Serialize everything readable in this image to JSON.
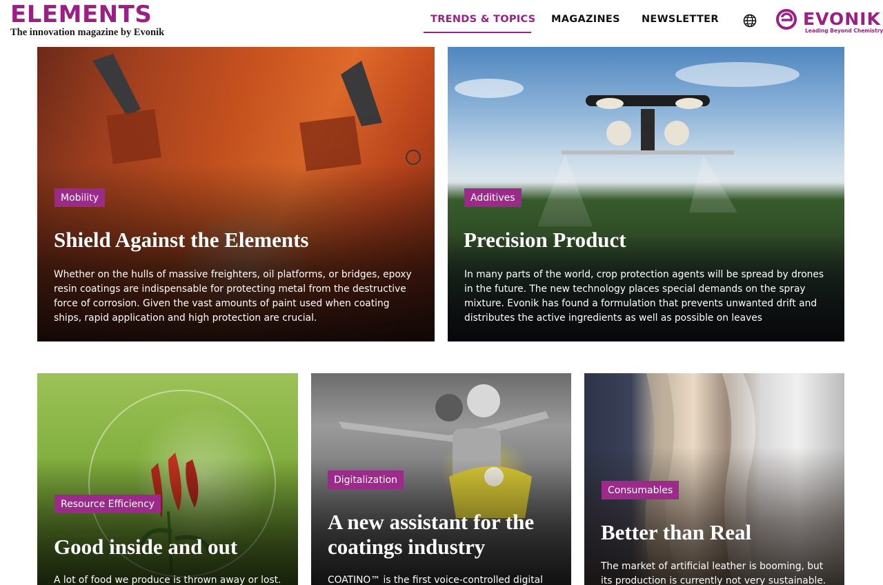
{
  "header": {
    "brand_title": "ELEMENTS",
    "brand_subtitle": "The innovation magazine by Evonik",
    "nav": [
      {
        "label": "TRENDS & TOPICS",
        "active": true
      },
      {
        "label": "MAGAZINES",
        "active": false
      },
      {
        "label": "NEWSLETTER",
        "active": false
      }
    ],
    "language_icon": "globe-icon",
    "logo_word": "EVONIK",
    "logo_tagline": "Leading Beyond Chemistry"
  },
  "colors": {
    "accent": "#9b1f85",
    "tag_bg": "#9b2a8a"
  },
  "cards": [
    {
      "tag": "Mobility",
      "title": "Shield Against the Elements",
      "description": "Whether on the hulls of massive freighters, oil platforms, or bridges, epoxy resin coatings are indispensable for protecting metal from the destructive force of corrosion. Given the vast amounts of paint used when coating ships, rapid application and high protection are crucial."
    },
    {
      "tag": "Additives",
      "title": "Precision Product",
      "description": "In many parts of the world, crop protection agents will be spread by drones in the future. The new technology places special demands on the spray mixture. Evonik has found a formulation that prevents unwanted drift and distributes the active ingredients as well as possible on leaves"
    },
    {
      "tag": "Resource Efficiency",
      "title": "Good inside and out",
      "description": "A lot of food we produce is thrown away or lost."
    },
    {
      "tag": "Digitalization",
      "title": "A new assistant for the coatings industry",
      "description": "COATINO™ is the first voice-controlled digital"
    },
    {
      "tag": "Consumables",
      "title": "Better than Real",
      "description": "The market of artificial leather is booming, but its production is currently not very sustainable."
    }
  ]
}
